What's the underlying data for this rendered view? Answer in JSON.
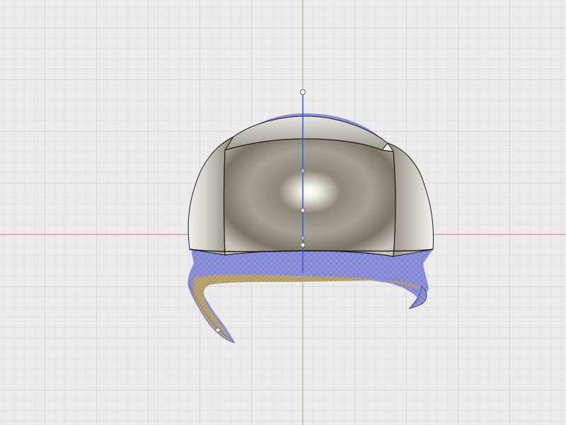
{
  "viewport": {
    "background": "#ececec",
    "grid_minor_color": "#dadada",
    "grid_major_color": "#c4c4c4",
    "x_axis_color": "#e06060",
    "y_axis_color": "#5ccf5c",
    "manipulator_color": "#2b5fd9"
  },
  "model": {
    "shell_color": "#9b9587",
    "shell_highlight": "#ffffff",
    "mesh_color": "#8b8fd8",
    "mesh_inner_color": "#b5a070",
    "edge_color": "#1a1a1a"
  },
  "icons": {
    "manipulator_handle": "circle-handle-icon"
  }
}
